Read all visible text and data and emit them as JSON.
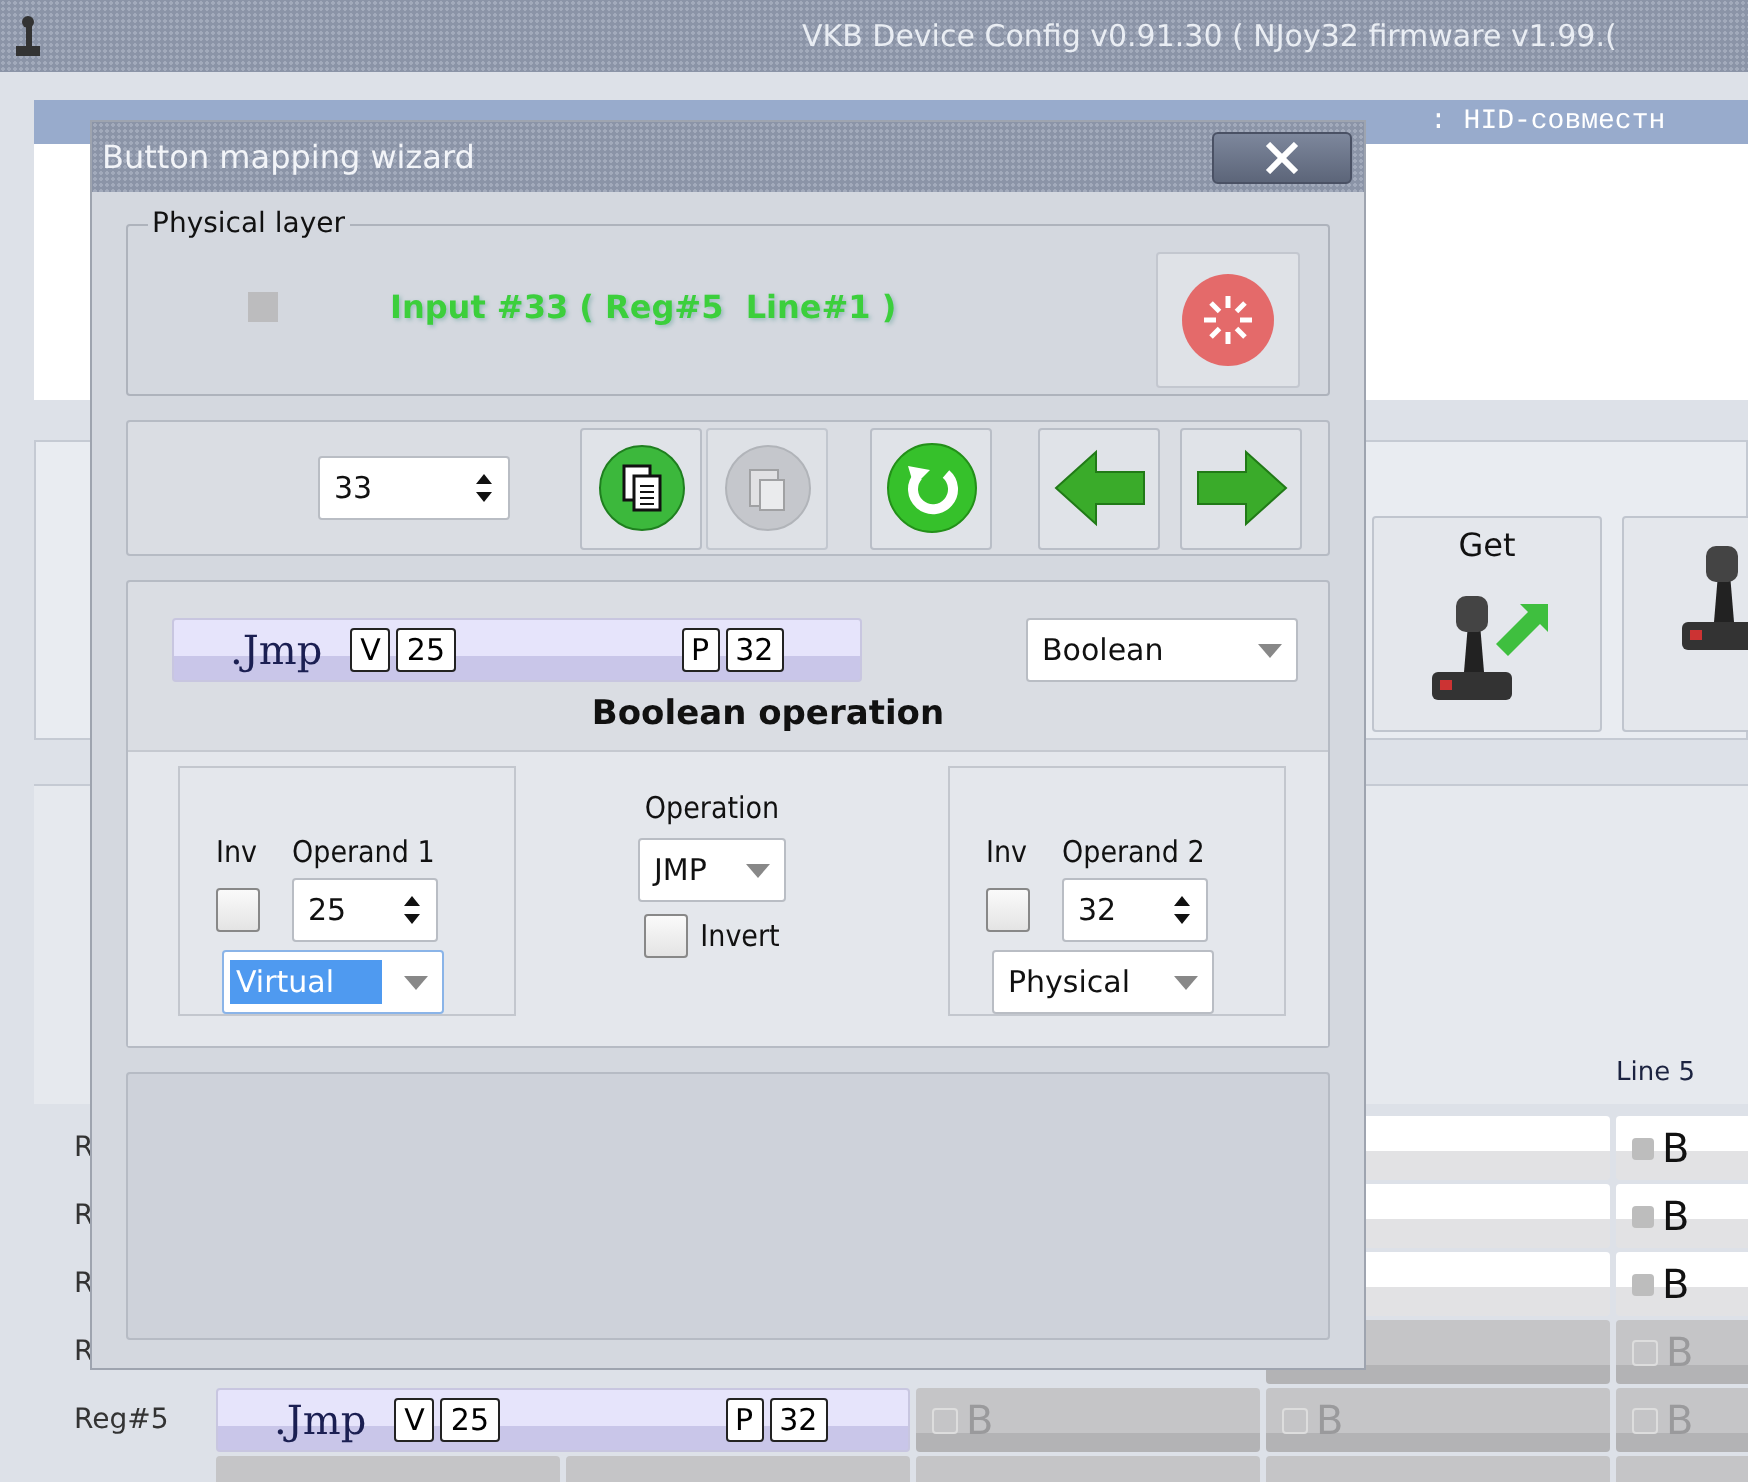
{
  "window": {
    "title": "VKB Device Config v0.91.30 ( NJoy32 firmware v1.99.("
  },
  "device_bar": {
    "text": ": HID-совместн"
  },
  "toolbar": {
    "buttons": [
      {
        "label": "Get",
        "kind": "get"
      },
      {
        "kind": "set"
      }
    ]
  },
  "line_header": {
    "label": "Line 5"
  },
  "grid": {
    "rows": [
      {
        "label": "R",
        "cells": [
          {
            "kind": "covered"
          },
          {
            "kind": "covered"
          },
          {
            "kind": "covered"
          },
          {
            "kind": "blank",
            "disabled": false
          },
          {
            "kind": "bit",
            "text": "B",
            "disabled": false
          }
        ]
      },
      {
        "label": "R",
        "cells": [
          {
            "kind": "covered"
          },
          {
            "kind": "covered"
          },
          {
            "kind": "covered"
          },
          {
            "kind": "blank",
            "disabled": false
          },
          {
            "kind": "bit",
            "text": "B",
            "disabled": false
          }
        ]
      },
      {
        "label": "R",
        "cells": [
          {
            "kind": "covered"
          },
          {
            "kind": "covered"
          },
          {
            "kind": "covered"
          },
          {
            "kind": "blank",
            "disabled": false
          },
          {
            "kind": "bit",
            "text": "B",
            "disabled": false
          }
        ]
      },
      {
        "label": "R",
        "cells": [
          {
            "kind": "covered"
          },
          {
            "kind": "covered"
          },
          {
            "kind": "covered"
          },
          {
            "kind": "blank",
            "disabled": true
          },
          {
            "kind": "bit",
            "text": "B",
            "disabled": true
          }
        ]
      },
      {
        "label": "Reg#5",
        "cells": [
          {
            "kind": "mapping",
            "op": ".Jmp",
            "operands": [
              {
                "type": "V",
                "value": "25"
              },
              {
                "type": "P",
                "value": "32"
              }
            ]
          },
          {
            "kind": "bit",
            "text": "B",
            "disabled": true
          },
          {
            "kind": "bit",
            "text": "B",
            "disabled": true
          },
          {
            "kind": "bit",
            "text": "B",
            "disabled": true
          }
        ]
      }
    ]
  },
  "dialog": {
    "title": "Button mapping wizard",
    "physical_layer": {
      "legend": "Physical layer",
      "active": false,
      "status": "Input #33 ( Reg#5  Line#1 )"
    },
    "navigation": {
      "input": "33",
      "buttons": [
        {
          "kind": "copy",
          "disabled": false
        },
        {
          "kind": "paste",
          "disabled": true
        },
        {
          "kind": "reset",
          "disabled": false
        },
        {
          "kind": "back",
          "disabled": false
        },
        {
          "kind": "forward",
          "disabled": false
        }
      ]
    },
    "operation": {
      "mapping": {
        "op": ".Jmp",
        "operands": [
          {
            "type": "V",
            "value": "25"
          },
          {
            "type": "P",
            "value": "32"
          }
        ]
      },
      "type": "Boolean",
      "heading": "Boolean operation",
      "operand_1": {
        "inv_label": "Inv",
        "label": "Operand 1",
        "inverted": false,
        "value": "25",
        "source": "Virtual",
        "focused": true
      },
      "operator": {
        "label": "Operation",
        "value": "JMP",
        "invert_label": "Invert",
        "inverted": false
      },
      "operand_2": {
        "inv_label": "Inv",
        "label": "Operand 2",
        "inverted": false,
        "value": "32",
        "source": "Physical",
        "focused": false
      }
    }
  }
}
